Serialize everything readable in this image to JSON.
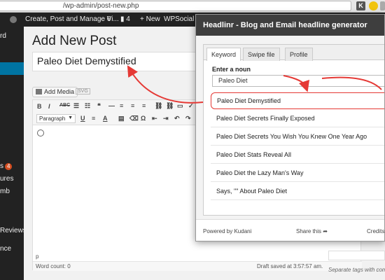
{
  "browser": {
    "url": "/wp-admin/post-new.php",
    "ext_k": "K"
  },
  "admin_bar": {
    "create_post": "Create, Post and Manage Vi...",
    "comments": "◌ 6",
    "updates": "▮ 4",
    "new": "+ New",
    "wpsocial": "WPSocial"
  },
  "sidebar": {
    "items": [
      {
        "label": "rd"
      },
      {
        "label": "s",
        "badge": "4"
      },
      {
        "label": "ures"
      },
      {
        "label": "mb"
      },
      {
        "label": "Reviews"
      },
      {
        "label": "nce"
      }
    ]
  },
  "editor": {
    "page_title": "Add New Post",
    "title_value": "Paleo Diet Demystified",
    "add_media": "Add Media",
    "kbd_chip": "SVG",
    "toolbar": {
      "bold": "B",
      "italic": "I",
      "strike": "ABC",
      "bullets": "☰",
      "numbers": "☷",
      "quote": "❝",
      "hr": "—",
      "align_left": "≡",
      "align_center": "≡",
      "align_right": "≡",
      "link": "⛓",
      "unlink": "⛓",
      "more": "▭",
      "spell": "✓",
      "fullscreen": "⤢",
      "kitchen": "▦",
      "paragraph": "Paragraph",
      "underline": "U",
      "justify": "≡",
      "text_color": "A",
      "paste_text": "▤",
      "clear": "⌫",
      "omega": "Ω",
      "outdent": "⇤",
      "indent": "⇥",
      "undo": "↶",
      "redo": "↷",
      "help": "?"
    },
    "path": "p",
    "word_count": "Word count: 0",
    "draft_saved": "Draft saved at 3:57:57 am."
  },
  "tags": {
    "help": "Separate tags with commo"
  },
  "popup": {
    "title": "Headlinr - Blog and Email headline generator",
    "tabs": [
      {
        "label": "Keyword"
      },
      {
        "label": "Swipe file"
      },
      {
        "label": "Profile"
      }
    ],
    "enter_noun": "Enter a noun",
    "noun_value": "Paleo Diet",
    "headlines": [
      {
        "text": "Paleo Diet Demystified"
      },
      {
        "text": "Paleo Diet Secrets Finally Exposed"
      },
      {
        "text": "Paleo Diet Secrets You Wish You Knew One Year Ago"
      },
      {
        "text": "Paleo Diet Stats Reveal All"
      },
      {
        "text": "Paleo Diet the Lazy Man's Way"
      },
      {
        "text": "Says, \"\" About Paleo Diet"
      }
    ],
    "footer": {
      "powered": "Powered by Kudani",
      "share": "Share this ➦",
      "credits": "Credits"
    }
  },
  "colors": {
    "accent_red": "#e53935",
    "admin_bar": "#222222",
    "active_menu": "#0074a2",
    "popup_header": "#3e3e3e"
  }
}
